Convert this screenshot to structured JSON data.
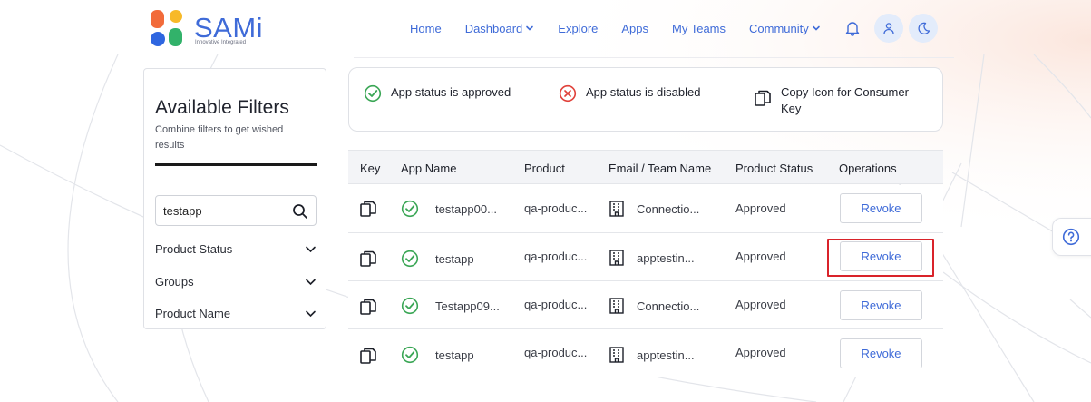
{
  "brand": {
    "name": "SAMi",
    "tagline": "Innovative Integrated"
  },
  "nav": {
    "items": [
      {
        "label": "Home",
        "dropdown": false
      },
      {
        "label": "Dashboard",
        "dropdown": true
      },
      {
        "label": "Explore",
        "dropdown": false
      },
      {
        "label": "Apps",
        "dropdown": false
      },
      {
        "label": "My Teams",
        "dropdown": false
      },
      {
        "label": "Community",
        "dropdown": true
      }
    ],
    "icons": [
      "bell-icon",
      "user-icon",
      "moon-icon"
    ]
  },
  "filters": {
    "title": "Available Filters",
    "subtitle": "Combine filters to get wished results",
    "search_value": "testapp",
    "groups": [
      {
        "label": "Product Status"
      },
      {
        "label": "Groups"
      },
      {
        "label": "Product Name"
      }
    ]
  },
  "legend": {
    "approved": "App status is approved",
    "disabled": "App status is disabled",
    "copy": "Copy Icon for Consumer Key"
  },
  "table": {
    "headers": [
      "Key",
      "App Name",
      "Product",
      "Email / Team Name",
      "Product Status",
      "Operations"
    ],
    "rows": [
      {
        "app_name": "testapp00...",
        "product": "qa-produc...",
        "team": "Connectio...",
        "status": "Approved",
        "action": "Revoke"
      },
      {
        "app_name": "testapp",
        "product": "qa-produc...",
        "team": "apptestin...",
        "status": "Approved",
        "action": "Revoke"
      },
      {
        "app_name": "Testapp09...",
        "product": "qa-produc...",
        "team": "Connectio...",
        "status": "Approved",
        "action": "Revoke"
      },
      {
        "app_name": "testapp",
        "product": "qa-produc...",
        "team": "apptestin...",
        "status": "Approved",
        "action": "Revoke"
      }
    ]
  },
  "colors": {
    "brand_blue": "#3f6bd8",
    "approved_green": "#3aa655",
    "disabled_red": "#e0413a",
    "highlight_red": "#d9232a",
    "logo_orange": "#f26b3a",
    "logo_yellow": "#f7b928",
    "logo_blue": "#2f66e0",
    "logo_green": "#32b26a"
  }
}
